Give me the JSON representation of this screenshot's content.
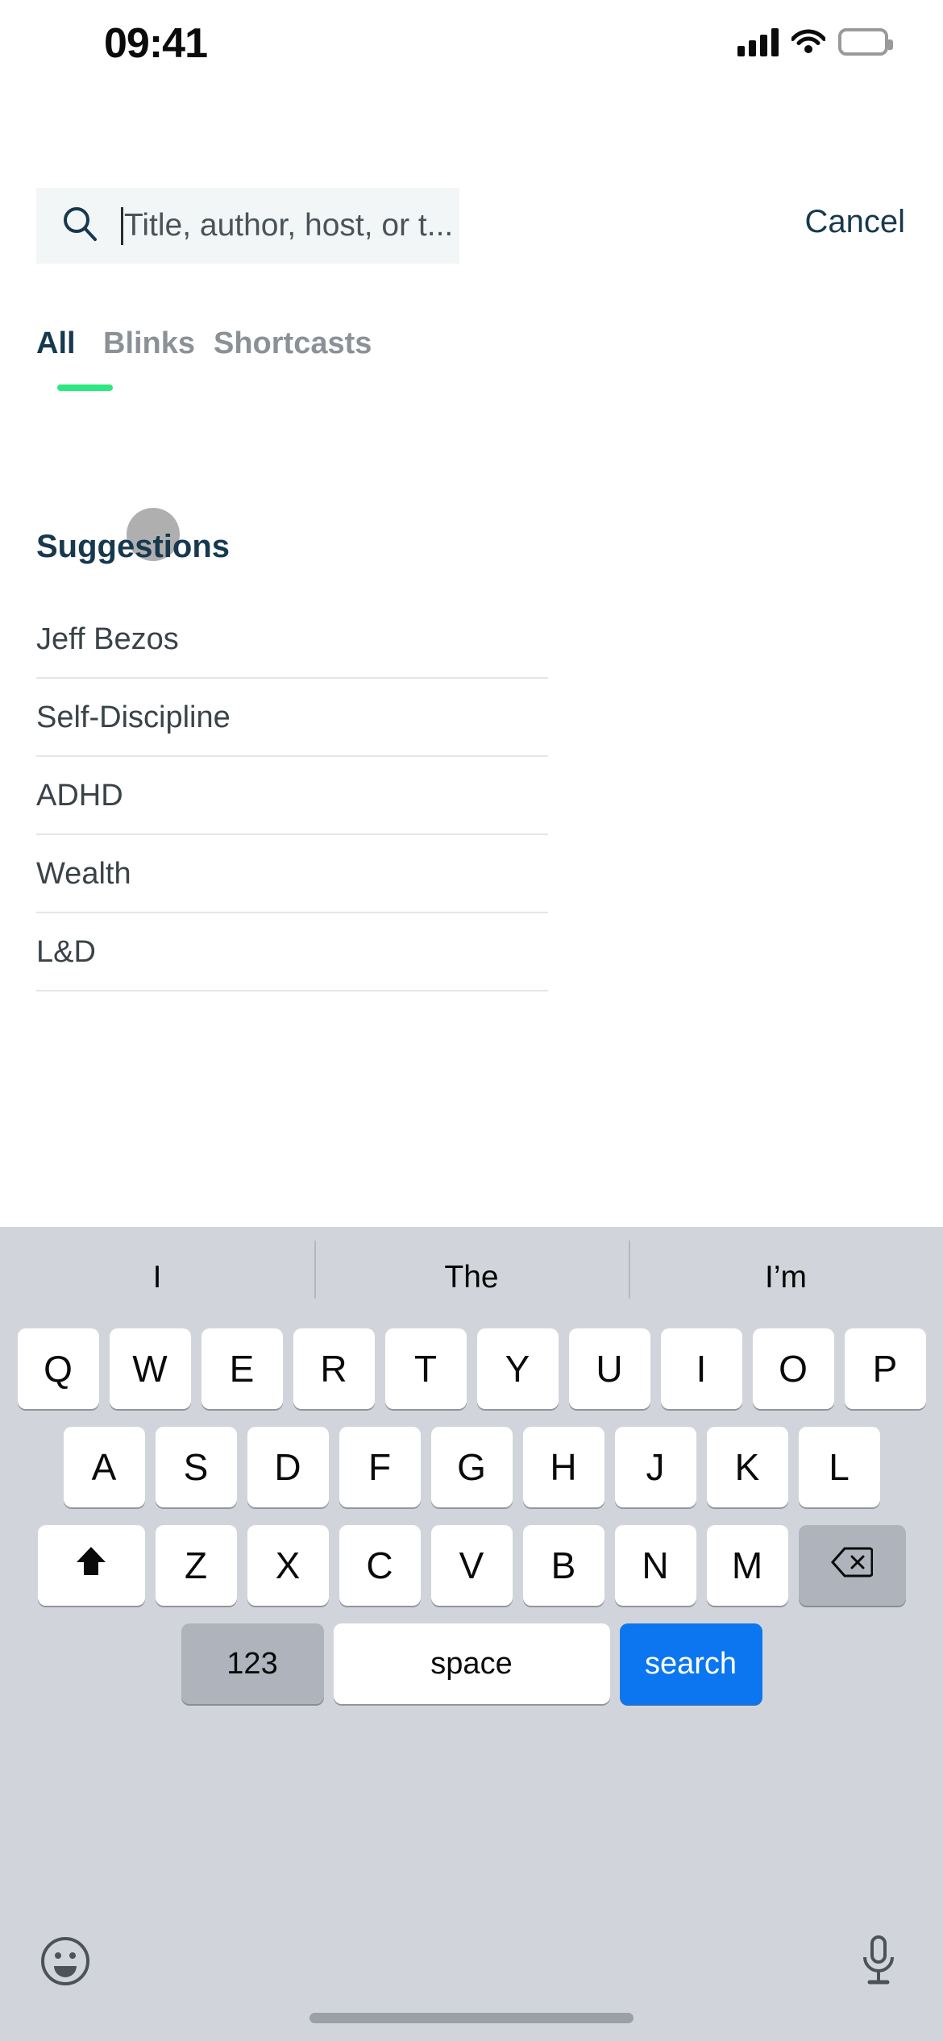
{
  "status_bar": {
    "time": "09:41",
    "cellular_icon": "cellular-bars-icon",
    "wifi_icon": "wifi-icon",
    "battery_icon": "battery-icon",
    "battery_color": "#fed400"
  },
  "search": {
    "placeholder": "Title, author, host, or t...",
    "value": "",
    "icon": "search-icon",
    "cancel_label": "Cancel",
    "field_background": "#f2f6f6",
    "cancel_color": "#17394f"
  },
  "tabs": {
    "active_index": 0,
    "active_underline_color": "#2ce881",
    "items": [
      {
        "label": "All"
      },
      {
        "label": "Blinks"
      },
      {
        "label": "Shortcasts"
      }
    ]
  },
  "suggestions": {
    "title": "Suggestions",
    "items": [
      {
        "label": "Jeff Bezos"
      },
      {
        "label": "Self-Discipline"
      },
      {
        "label": "ADHD"
      },
      {
        "label": "Wealth"
      },
      {
        "label": "L&D"
      }
    ]
  },
  "keyboard": {
    "predictions": [
      "I",
      "The",
      "I’m"
    ],
    "row1": [
      "Q",
      "W",
      "E",
      "R",
      "T",
      "Y",
      "U",
      "I",
      "O",
      "P"
    ],
    "row2": [
      "A",
      "S",
      "D",
      "F",
      "G",
      "H",
      "J",
      "K",
      "L"
    ],
    "row3": [
      "Z",
      "X",
      "C",
      "V",
      "B",
      "N",
      "M"
    ],
    "shift_icon": "shift-icon",
    "backspace_icon": "backspace-icon",
    "numbers_label": "123",
    "space_label": "space",
    "search_label": "search",
    "search_key_color": "#0b76ef",
    "emoji_icon": "emoji-icon",
    "mic_icon": "microphone-icon"
  }
}
